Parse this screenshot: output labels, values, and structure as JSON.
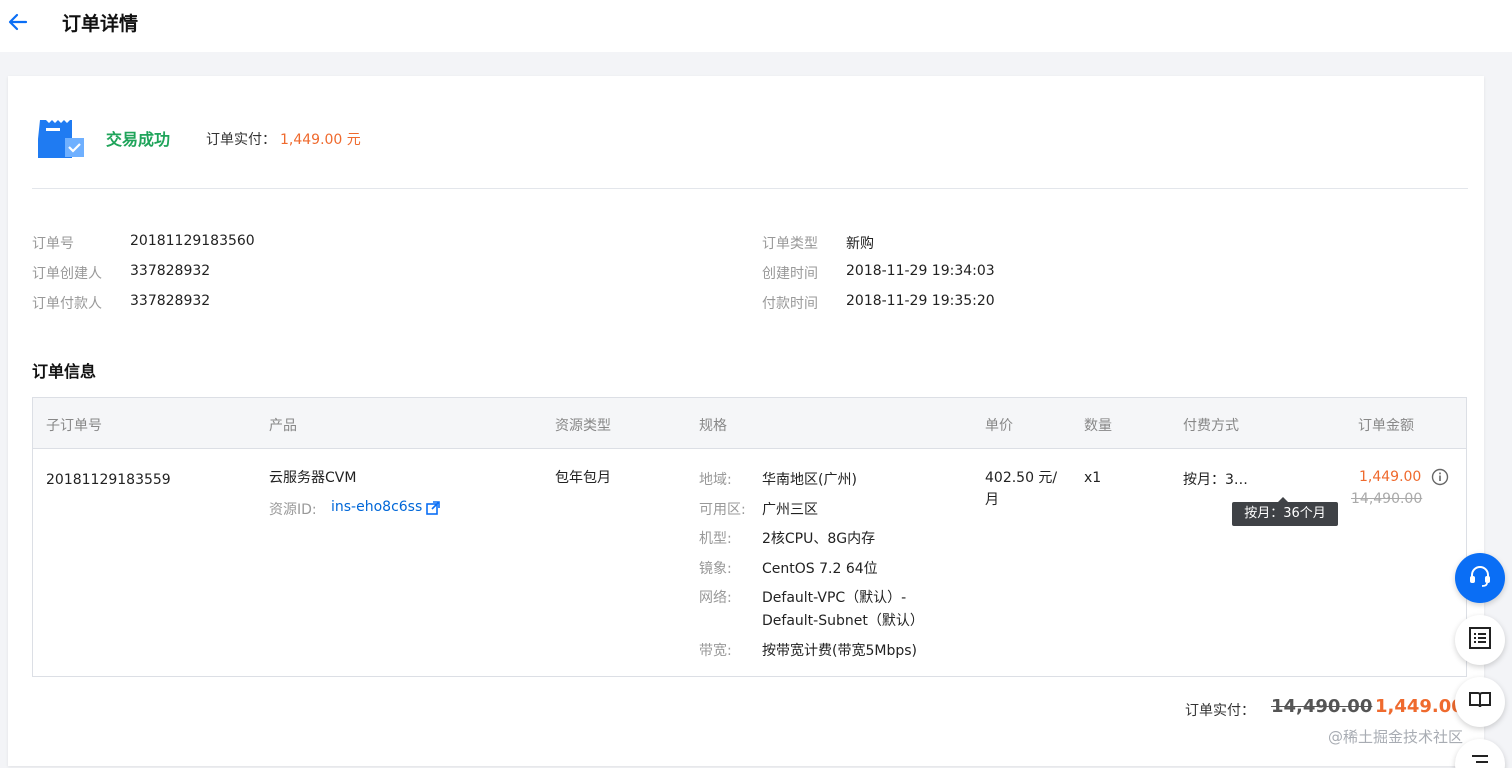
{
  "header": {
    "title": "订单详情"
  },
  "status": {
    "text": "交易成功",
    "paid_label": "订单实付：",
    "paid_value": "1,449.00 元"
  },
  "meta": {
    "left": [
      {
        "label": "订单号",
        "value": "20181129183560"
      },
      {
        "label": "订单创建人",
        "value": "337828932"
      },
      {
        "label": "订单付款人",
        "value": "337828932"
      }
    ],
    "right": [
      {
        "label": "订单类型",
        "value": "新购"
      },
      {
        "label": "创建时间",
        "value": "2018-11-29 19:34:03"
      },
      {
        "label": "付款时间",
        "value": "2018-11-29 19:35:20"
      }
    ]
  },
  "section": {
    "title": "订单信息"
  },
  "table": {
    "headers": [
      "子订单号",
      "产品",
      "资源类型",
      "规格",
      "单价",
      "数量",
      "付费方式",
      "订单金额"
    ],
    "row": {
      "sub_order_id": "20181129183559",
      "product": "云服务器CVM",
      "resource_label": "资源ID:",
      "resource_id": "ins-eho8c6ss",
      "resource_type": "包年包月",
      "specs": [
        {
          "label": "地域:",
          "value": "华南地区(广州)"
        },
        {
          "label": "可用区:",
          "value": "广州三区"
        },
        {
          "label": "机型:",
          "value": "2核CPU、8G内存"
        },
        {
          "label": "镜象:",
          "value": "CentOS 7.2 64位"
        },
        {
          "label": "网络:",
          "value": "Default-VPC（默认）-",
          "value2": "Default-Subnet（默认）"
        },
        {
          "label": "带宽:",
          "value": "按带宽计费(带宽5Mbps)"
        }
      ],
      "unit_price_line1": "402.50 元/",
      "unit_price_line2": "月",
      "quantity": "x1",
      "billing": "按月：3…",
      "billing_tooltip": "按月：36个月",
      "amount": "1,449.00",
      "amount_original": "14,490.00"
    }
  },
  "total": {
    "label": "订单实付：",
    "original": "14,490.00",
    "value": "1,449.00"
  },
  "watermark": "@稀土掘金技术社区"
}
